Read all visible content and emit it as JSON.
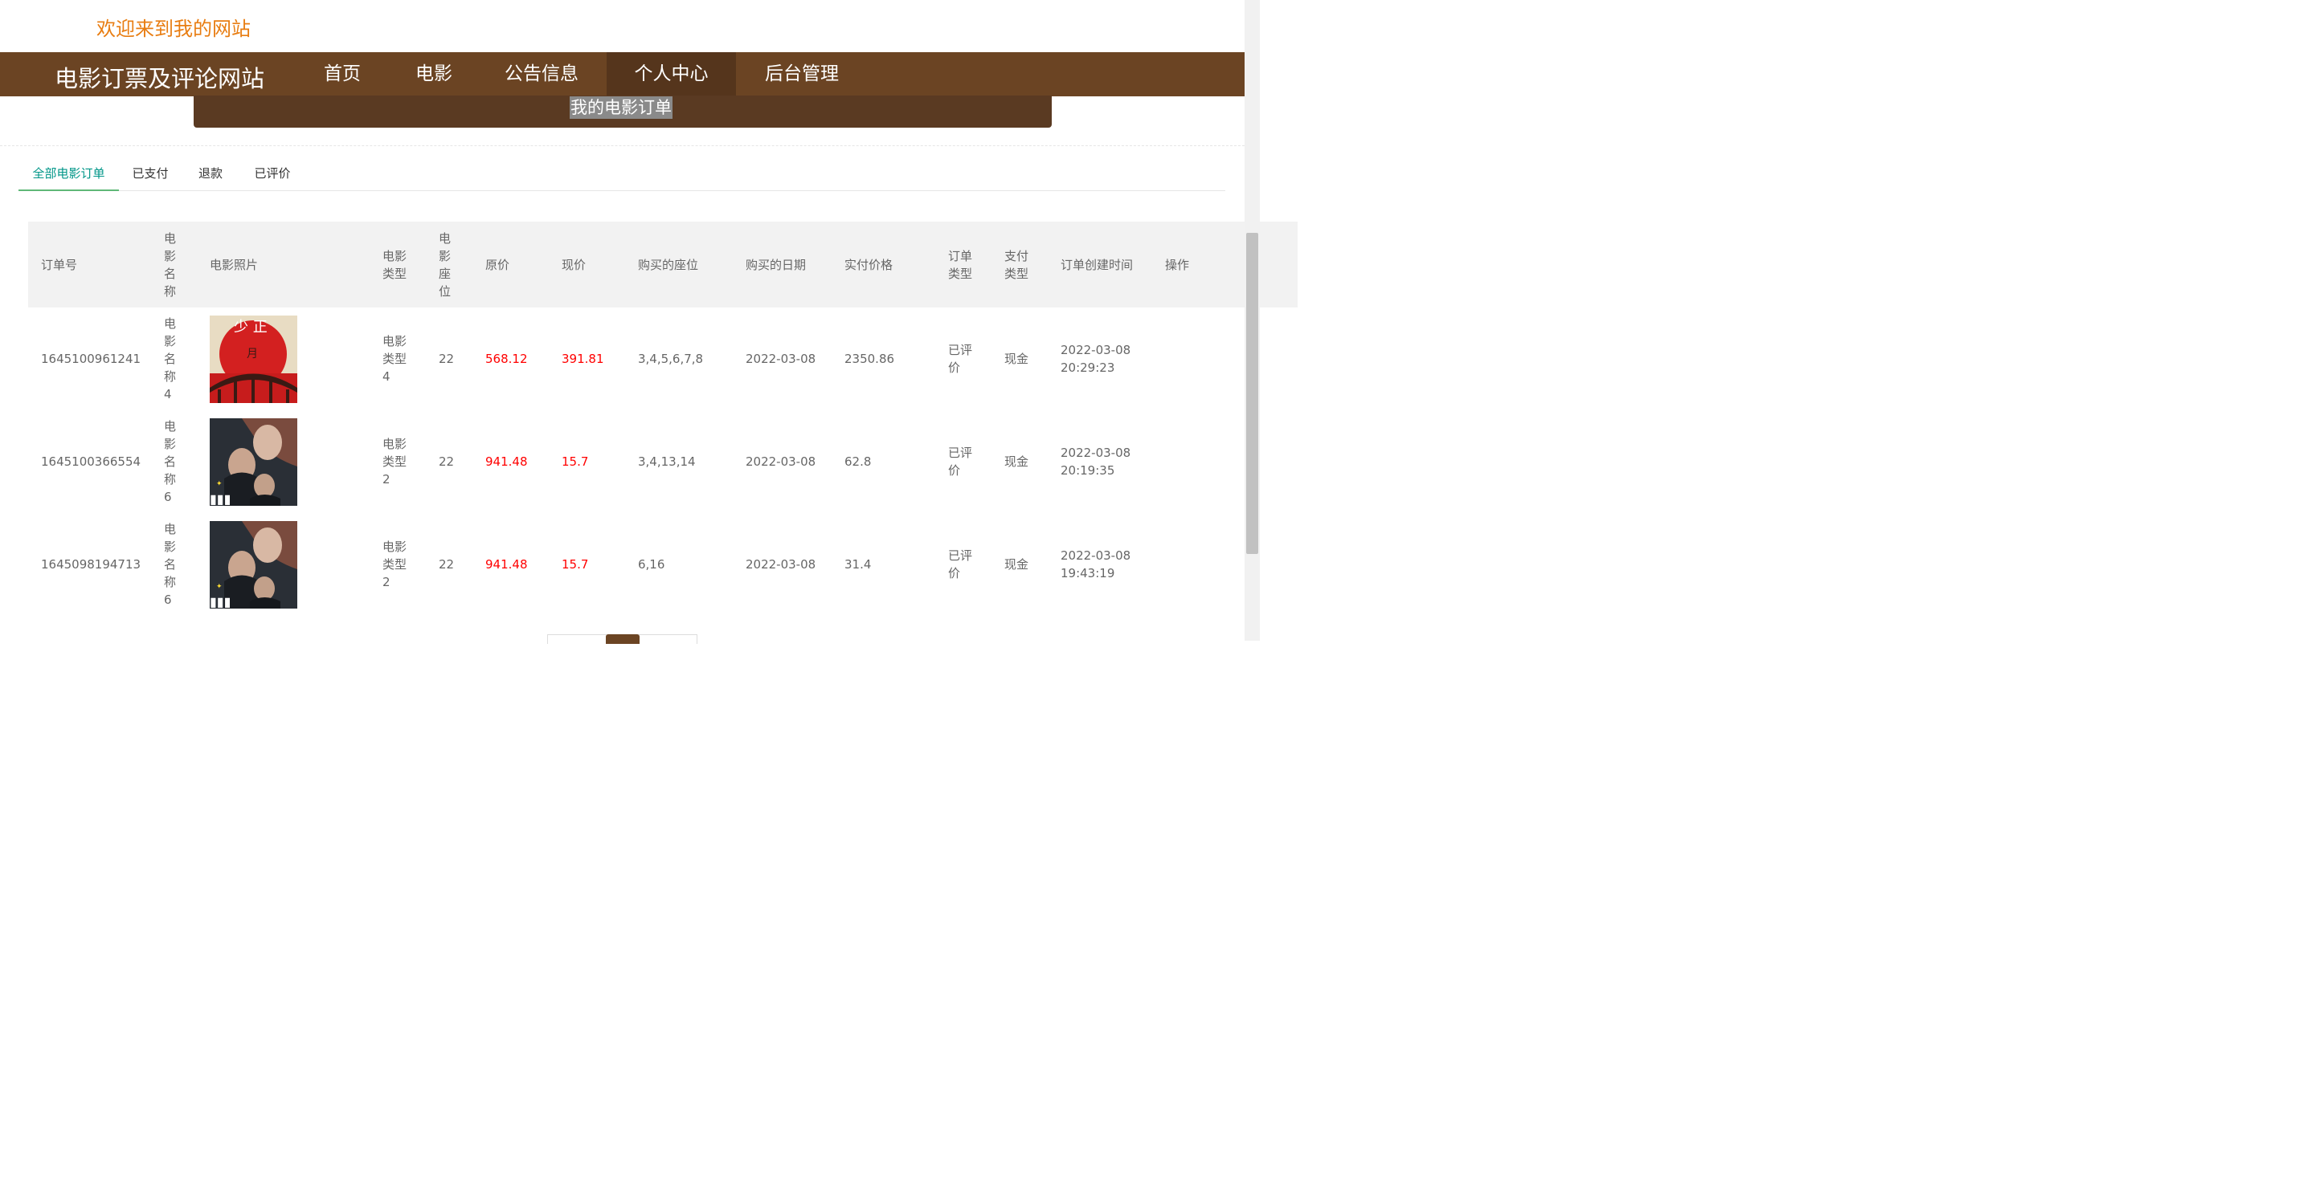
{
  "welcome": "欢迎来到我的网站",
  "brand": "电影订票及评论网站",
  "nav": [
    "首页",
    "电影",
    "公告信息",
    "个人中心",
    "后台管理"
  ],
  "sub_menu_item": "我的电影订单",
  "tabs": [
    "全部电影订单",
    "已支付",
    "退款",
    "已评价"
  ],
  "table": {
    "headers": [
      "订单号",
      "电影名称",
      "电影照片",
      "电影类型",
      "电影座位",
      "原价",
      "现价",
      "购买的座位",
      "购买的日期",
      "实付价格",
      "订单类型",
      "支付类型",
      "订单创建时间",
      "操作"
    ],
    "rows": [
      {
        "order_no": "1645100961241",
        "name": "电影名称4",
        "poster": "poster-red-moon",
        "type": "电影类型4",
        "seat": "22",
        "orig_price": "568.12",
        "cur_price": "391.81",
        "seats_bought": "3,4,5,6,7,8",
        "date": "2022-03-08",
        "paid": "2350.86",
        "order_type": "已评价",
        "pay_type": "现金",
        "created": "2022-03-08 20:29:23"
      },
      {
        "order_no": "1645100366554",
        "name": "电影名称6",
        "poster": "poster-detective",
        "type": "电影类型2",
        "seat": "22",
        "orig_price": "941.48",
        "cur_price": "15.7",
        "seats_bought": "3,4,13,14",
        "date": "2022-03-08",
        "paid": "62.8",
        "order_type": "已评价",
        "pay_type": "现金",
        "created": "2022-03-08 20:19:35"
      },
      {
        "order_no": "1645098194713",
        "name": "电影名称6",
        "poster": "poster-detective",
        "type": "电影类型2",
        "seat": "22",
        "orig_price": "941.48",
        "cur_price": "15.7",
        "seats_bought": "6,16",
        "date": "2022-03-08",
        "paid": "31.4",
        "order_type": "已评价",
        "pay_type": "现金",
        "created": "2022-03-08 19:43:19"
      }
    ]
  },
  "colors": {
    "nav_bg": "#6b4423",
    "accent_tab": "#009688",
    "welcome": "#e87d12",
    "price": "#ff0000"
  }
}
